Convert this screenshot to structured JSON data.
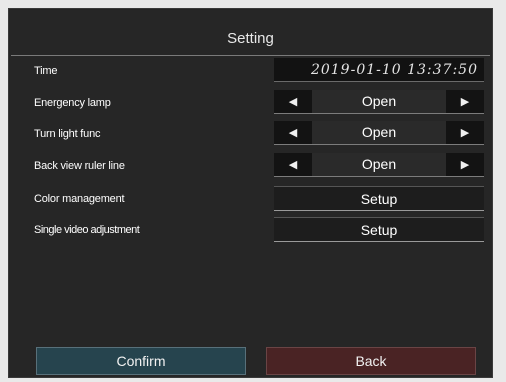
{
  "header": {
    "title": "Setting"
  },
  "rows": {
    "time": {
      "label": "Time",
      "value": "2019-01-10 13:37:50"
    },
    "emergency_lamp": {
      "label": "Energency lamp",
      "value": "Open"
    },
    "turn_light": {
      "label": "Turn light func",
      "value": "Open"
    },
    "back_view": {
      "label": "Back view ruler line",
      "value": "Open"
    },
    "color_management": {
      "label": "Color management",
      "button": "Setup"
    },
    "single_video": {
      "label": "Single video adjustment",
      "button": "Setup"
    }
  },
  "arrows": {
    "left": "◀",
    "right": "▶"
  },
  "footer": {
    "confirm_label": "Confirm",
    "back_label": "Back"
  }
}
